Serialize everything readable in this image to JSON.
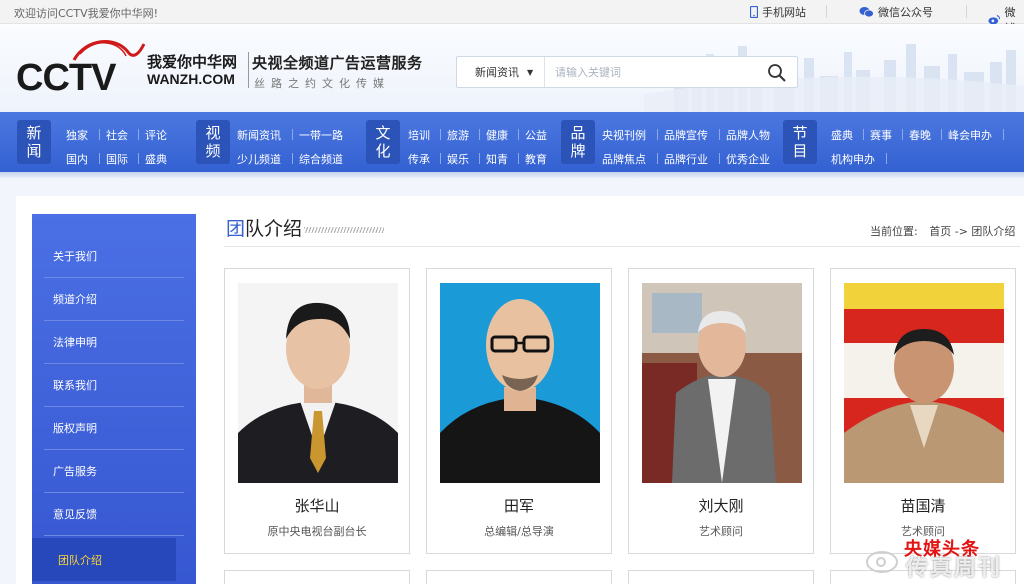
{
  "topbar": {
    "welcome": "欢迎访问CCTV我爱你中华网!",
    "mobile": "手机网站",
    "wechat": "微信公众号",
    "weibo": "微博"
  },
  "header": {
    "logo_brand": "我爱你中华网",
    "logo_domain": "WANZH.COM",
    "slogan_main": "央视全频道广告运营服务",
    "slogan_sub": "丝路之约文化传媒"
  },
  "search": {
    "category": "新闻资讯",
    "placeholder": "请输入关键词",
    "icon": "search-icon"
  },
  "nav": {
    "groups": [
      {
        "cat": "新闻",
        "row1": [
          "独家",
          "社会",
          "评论"
        ],
        "row2": [
          "国内",
          "国际",
          "盛典"
        ]
      },
      {
        "cat": "视频",
        "row1": [
          "新闻资讯",
          "一带一路"
        ],
        "row2": [
          "少儿频道",
          "综合频道"
        ]
      },
      {
        "cat": "文化",
        "row1": [
          "培训",
          "旅游",
          "健康",
          "公益"
        ],
        "row2": [
          "传承",
          "娱乐",
          "知青",
          "教育"
        ]
      },
      {
        "cat": "品牌",
        "row1": [
          "央视刊例",
          "品牌宣传",
          "品牌人物"
        ],
        "row2": [
          "品牌焦点",
          "品牌行业",
          "优秀企业"
        ]
      },
      {
        "cat": "节目",
        "row1": [
          "盛典",
          "赛事",
          "春晚",
          "峰会申办"
        ],
        "row2": [
          "机构申办"
        ]
      }
    ]
  },
  "sidebar": {
    "items": [
      "关于我们",
      "频道介绍",
      "法律申明",
      "联系我们",
      "版权声明",
      "广告服务",
      "意见反馈",
      "团队介绍"
    ],
    "active_index": 7
  },
  "page": {
    "title_first": "团",
    "title_rest": "队介绍",
    "breadcrumb_label": "当前位置:",
    "breadcrumb_home": "首页",
    "breadcrumb_sep": "->",
    "breadcrumb_current": "团队介绍"
  },
  "team": [
    {
      "name": "张华山",
      "role": "原中央电视台副台长"
    },
    {
      "name": "田军",
      "role": "总编辑/总导演"
    },
    {
      "name": "刘大刚",
      "role": "艺术顾问"
    },
    {
      "name": "苗国清",
      "role": "艺术顾问"
    }
  ],
  "watermark": {
    "line1": "央媒头条",
    "line2": "传真周刊"
  },
  "colors": {
    "nav_blue": "#3d6ad9",
    "nav_cat_box": "#2b53b8",
    "sidebar_blue": "#4262da",
    "active_text": "#ffd633",
    "title_accent": "#3461d2"
  }
}
